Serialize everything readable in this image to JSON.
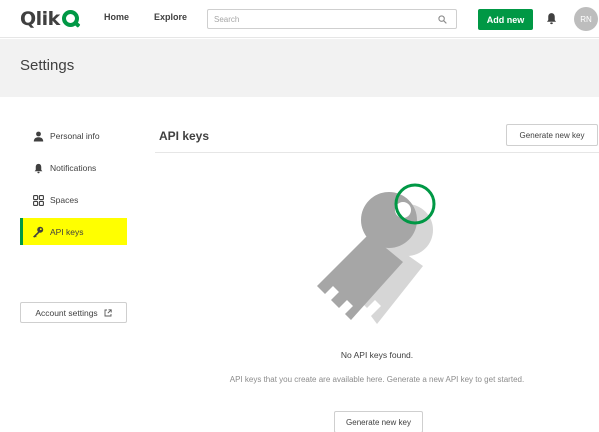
{
  "topbar": {
    "logo_text": "Qlik",
    "nav": {
      "home": "Home",
      "explore": "Explore"
    },
    "search_placeholder": "Search",
    "add_new_label": "Add new",
    "avatar_initials": "RN",
    "brand_color": "#009845"
  },
  "settings": {
    "title": "Settings"
  },
  "sidebar": {
    "items": [
      {
        "label": "Personal info",
        "icon": "person-icon"
      },
      {
        "label": "Notifications",
        "icon": "bell-icon"
      },
      {
        "label": "Spaces",
        "icon": "spaces-grid-icon"
      },
      {
        "label": "API keys",
        "icon": "key-icon",
        "active": true
      }
    ],
    "account_settings_label": "Account settings",
    "highlight_color": "#ffff00"
  },
  "main": {
    "title": "API keys",
    "generate_label": "Generate new key",
    "empty_title": "No API keys found.",
    "empty_description": "API keys that you create are available here. Generate a new API key to get started.",
    "generate_label_bottom": "Generate new key"
  }
}
